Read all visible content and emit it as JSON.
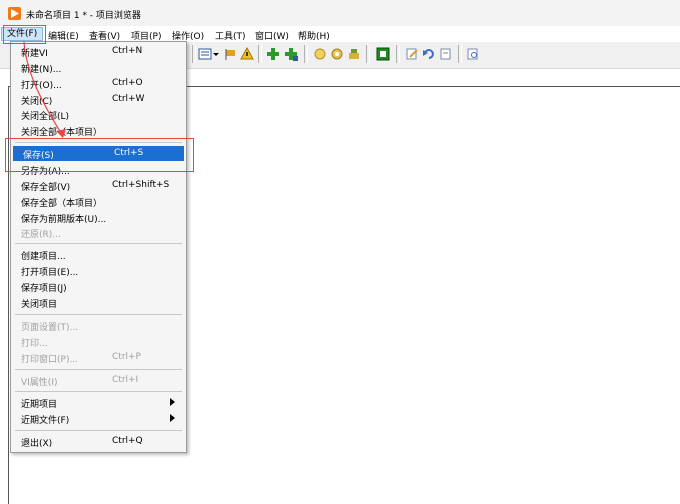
{
  "window": {
    "title": "未命名项目 1 * - 项目浏览器"
  },
  "menubar": {
    "items": [
      "文件(F)",
      "编辑(E)",
      "查看(V)",
      "项目(P)",
      "操作(O)",
      "工具(T)",
      "窗口(W)",
      "帮助(H)"
    ],
    "active": "文件(F)"
  },
  "toolbar": {
    "icons": [
      "new-file-icon",
      "list-view-icon",
      "dropdown-arrow-icon",
      "flag-icon",
      "warning-icon",
      "add-icon",
      "add-item-icon",
      "properties-icon",
      "settings-icon",
      "tools-icon",
      "build-icon",
      "rename-icon",
      "undo-icon",
      "redo-icon",
      "search-icon"
    ]
  },
  "file_menu": {
    "items": [
      {
        "label": "新建VI",
        "shortcut": "Ctrl+N",
        "enabled": true
      },
      {
        "label": "新建(N)...",
        "shortcut": "",
        "enabled": true
      },
      {
        "label": "打开(O)...",
        "shortcut": "Ctrl+O",
        "enabled": true
      },
      {
        "label": "关闭(C)",
        "shortcut": "Ctrl+W",
        "enabled": true
      },
      {
        "label": "关闭全部(L)",
        "shortcut": "",
        "enabled": true
      },
      {
        "label": "关闭全部（本项目）",
        "shortcut": "",
        "enabled": true
      },
      {
        "label": "保存(S)",
        "shortcut": "Ctrl+S",
        "enabled": true,
        "selected": true
      },
      {
        "label": "另存为(A)...",
        "shortcut": "",
        "enabled": true
      },
      {
        "label": "保存全部(V)",
        "shortcut": "Ctrl+Shift+S",
        "enabled": true
      },
      {
        "label": "保存全部（本项目）",
        "shortcut": "",
        "enabled": true
      },
      {
        "label": "保存为前期版本(U)...",
        "shortcut": "",
        "enabled": true
      },
      {
        "label": "还原(R)...",
        "shortcut": "",
        "enabled": false
      },
      {
        "label": "创建项目...",
        "shortcut": "",
        "enabled": true
      },
      {
        "label": "打开项目(E)...",
        "shortcut": "",
        "enabled": true
      },
      {
        "label": "保存项目(J)",
        "shortcut": "",
        "enabled": true
      },
      {
        "label": "关闭项目",
        "shortcut": "",
        "enabled": true
      },
      {
        "label": "页面设置(T)...",
        "shortcut": "",
        "enabled": false
      },
      {
        "label": "打印...",
        "shortcut": "",
        "enabled": false
      },
      {
        "label": "打印窗口(P)...",
        "shortcut": "Ctrl+P",
        "enabled": false
      },
      {
        "label": "VI属性(I)",
        "shortcut": "Ctrl+I",
        "enabled": false
      },
      {
        "label": "近期项目",
        "shortcut": "",
        "enabled": true,
        "submenu": true
      },
      {
        "label": "近期文件(F)",
        "shortcut": "",
        "enabled": true,
        "submenu": true
      },
      {
        "label": "退出(X)",
        "shortcut": "Ctrl+Q",
        "enabled": true
      }
    ]
  },
  "colors": {
    "selection": "#1a6fd0",
    "annotation": "#e84646",
    "app_icon": "#f07a18",
    "menu_highlight": "#cfe4f7"
  }
}
